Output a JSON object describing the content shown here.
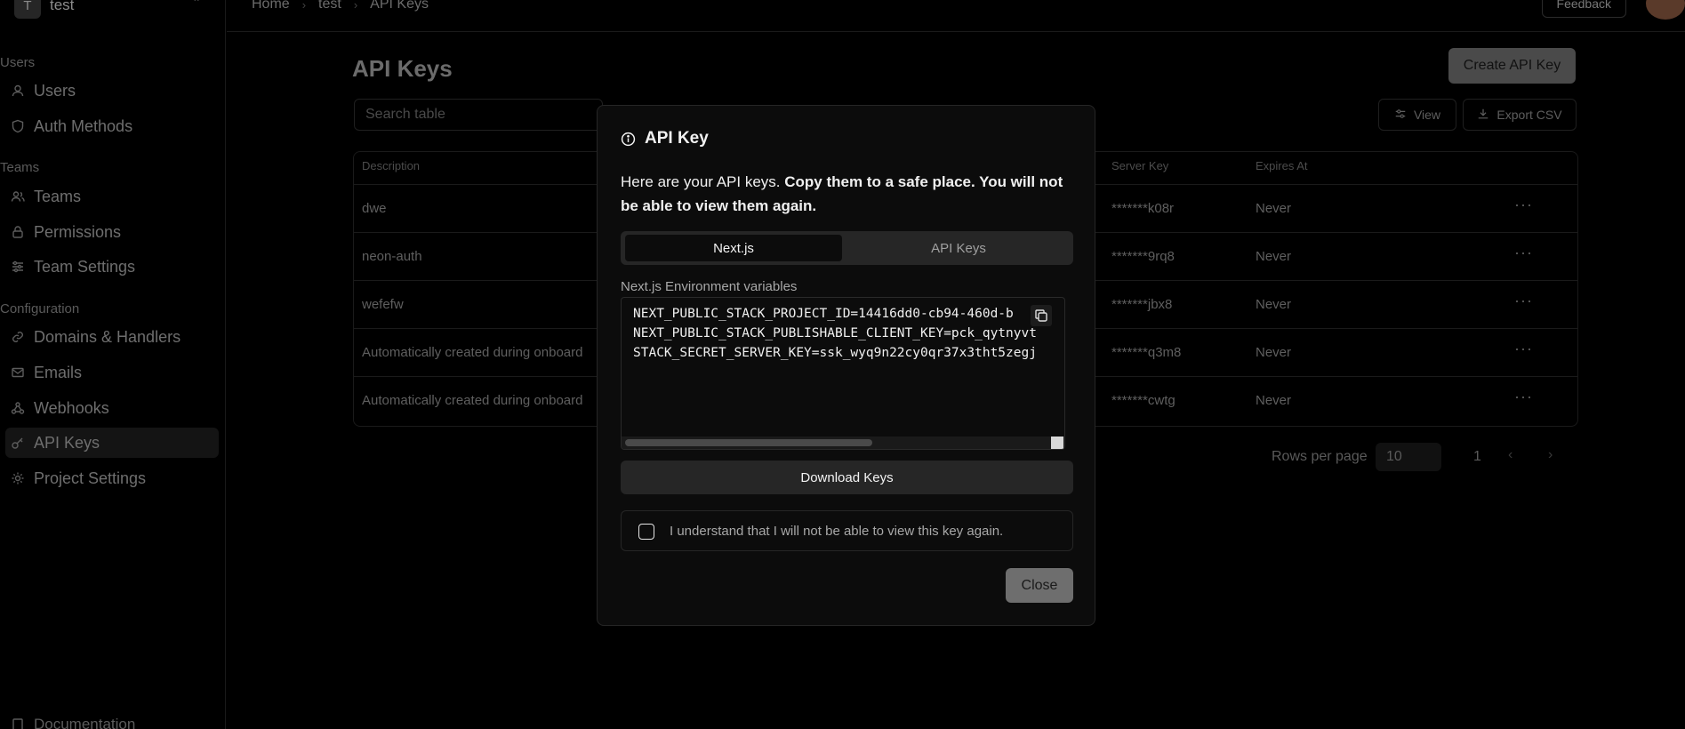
{
  "project": {
    "avatar_letter": "T",
    "name": "test"
  },
  "sidebar": {
    "sections": {
      "users": "Users",
      "teams": "Teams",
      "configuration": "Configuration"
    },
    "items": [
      {
        "label": "Users",
        "icon": "user-icon"
      },
      {
        "label": "Auth Methods",
        "icon": "shield-icon"
      },
      {
        "label": "Teams",
        "icon": "users-icon"
      },
      {
        "label": "Permissions",
        "icon": "lock-icon"
      },
      {
        "label": "Team Settings",
        "icon": "sliders-icon"
      },
      {
        "label": "Domains & Handlers",
        "icon": "link-icon"
      },
      {
        "label": "Emails",
        "icon": "mail-icon"
      },
      {
        "label": "Webhooks",
        "icon": "webhook-icon"
      },
      {
        "label": "API Keys",
        "icon": "key-icon",
        "active": true
      },
      {
        "label": "Project Settings",
        "icon": "gear-icon"
      }
    ],
    "documentation": "Documentation"
  },
  "topbar": {
    "breadcrumbs": [
      "Home",
      "test",
      "API Keys"
    ],
    "feedback": "Feedback"
  },
  "page": {
    "title": "API Keys",
    "create_button": "Create API Key",
    "search_placeholder": "Search table",
    "view_button": "View",
    "export_button": "Export CSV"
  },
  "table": {
    "columns": {
      "description": "Description",
      "server_key": "Server Key",
      "expires_at": "Expires At"
    },
    "rows": [
      {
        "description": "dwe",
        "server_key": "*******k08r",
        "expires_at": "Never"
      },
      {
        "description": "neon-auth",
        "server_key": "*******9rq8",
        "expires_at": "Never"
      },
      {
        "description": "wefefw",
        "server_key": "*******jbx8",
        "expires_at": "Never"
      },
      {
        "description": "Automatically created during onboard",
        "server_key": "*******q3m8",
        "expires_at": "Never"
      },
      {
        "description": "Automatically created during onboard",
        "server_key": "*******cwtg",
        "expires_at": "Never"
      }
    ],
    "row_actions": "···"
  },
  "pagination": {
    "rows_label": "Rows per page",
    "rows_value": "10",
    "page": "1"
  },
  "modal": {
    "title": "API Key",
    "desc_plain": "Here are your API keys. ",
    "desc_bold": "Copy them to a safe place. You will not be able to view them again.",
    "tabs": [
      "Next.js",
      "API Keys"
    ],
    "active_tab": "Next.js",
    "env_label": "Next.js Environment variables",
    "code_lines": [
      "NEXT_PUBLIC_STACK_PROJECT_ID=14416dd0-cb94-460d-b",
      "NEXT_PUBLIC_STACK_PUBLISHABLE_CLIENT_KEY=pck_qytnyvt",
      "STACK_SECRET_SERVER_KEY=ssk_wyq9n22cy0qr37x3tht5zegj"
    ],
    "download_button": "Download Keys",
    "confirm_text": "I understand that I will not be able to view this key again.",
    "confirm_checked": false,
    "close_button": "Close"
  }
}
